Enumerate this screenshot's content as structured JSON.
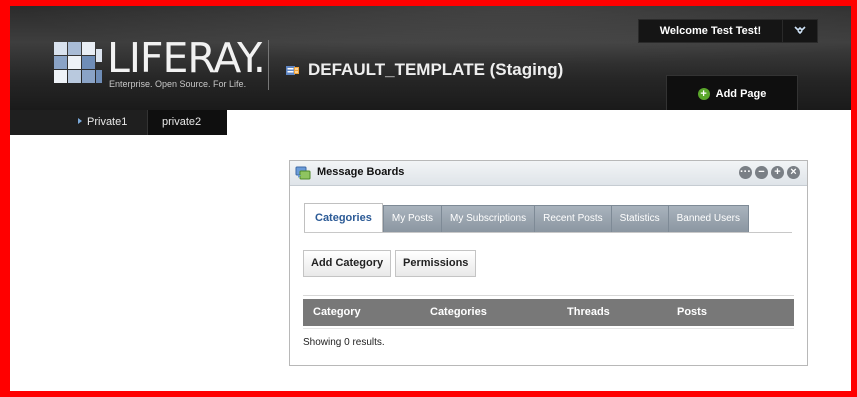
{
  "header": {
    "logo_text": "LIFERAY.",
    "logo_tagline": "Enterprise. Open Source. For Life.",
    "site_title": "DEFAULT_TEMPLATE (Staging)",
    "welcome_label": "Welcome Test Test!",
    "add_page_label": "Add Page"
  },
  "nav": {
    "items": [
      {
        "label": "Private1",
        "active": true
      },
      {
        "label": "private2",
        "active": false
      }
    ]
  },
  "portlet": {
    "title": "Message Boards",
    "tabs": [
      "Categories",
      "My Posts",
      "My Subscriptions",
      "Recent Posts",
      "Statistics",
      "Banned Users"
    ],
    "active_tab": "Categories",
    "buttons": {
      "add_category": "Add Category",
      "permissions": "Permissions"
    },
    "table": {
      "headers": [
        "Category",
        "Categories",
        "Threads",
        "Posts"
      ],
      "rows": []
    },
    "results_text": "Showing 0 results."
  },
  "colors": {
    "frame": "#ff0000",
    "header_bg": "#2b2b2b",
    "tab_bg": "#98a3ae",
    "table_header_bg": "#787878",
    "active_tab_text": "#2b5a96"
  }
}
